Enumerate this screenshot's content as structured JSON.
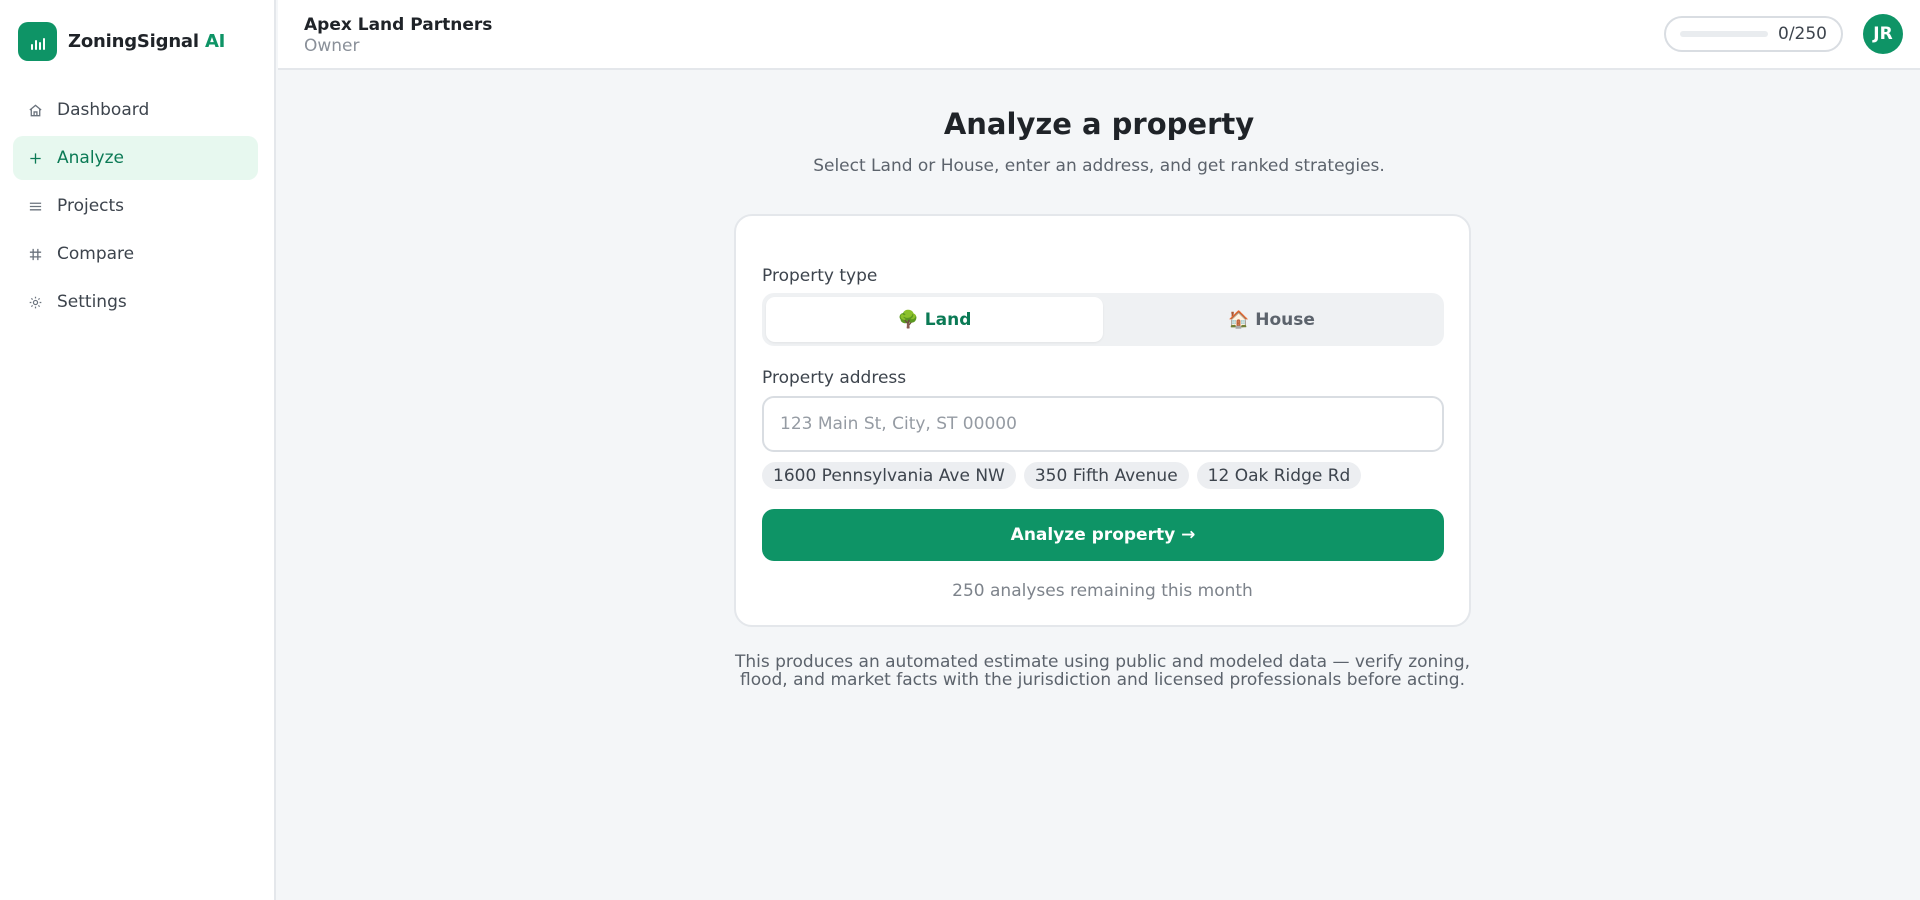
{
  "brand": {
    "name": "ZoningSignal",
    "suffix": "AI",
    "icon": "bar-chart-icon"
  },
  "nav": {
    "items": [
      {
        "label": "Dashboard",
        "icon": "home-icon",
        "active": false
      },
      {
        "label": "Analyze",
        "icon": "plus-icon",
        "active": true
      },
      {
        "label": "Projects",
        "icon": "list-icon",
        "active": false
      },
      {
        "label": "Compare",
        "icon": "grid-icon",
        "active": false
      },
      {
        "label": "Settings",
        "icon": "gear-icon",
        "active": false
      }
    ]
  },
  "header": {
    "org_name": "Apex Land Partners",
    "role": "Owner",
    "usage": {
      "label": "0/250",
      "fraction": 0
    },
    "avatar_initials": "JR"
  },
  "main": {
    "title": "Analyze a property",
    "subtitle": "Select Land or House, enter an address, and get ranked strategies.",
    "form": {
      "type_label": "Property type",
      "types": [
        {
          "emoji": "🌳",
          "label": "Land",
          "selected": true
        },
        {
          "emoji": "🏠",
          "label": "House",
          "selected": false
        }
      ],
      "address_label": "Property address",
      "address_value": "",
      "address_placeholder": "123 Main St, City, ST 00000",
      "suggestions": [
        "1600 Pennsylvania Ave NW",
        "350 Fifth Avenue",
        "12 Oak Ridge Rd"
      ],
      "submit_label": "Analyze property →",
      "remaining_text": "250 analyses remaining this month"
    },
    "disclaimer": "This produces an automated estimate using public and modeled data — verify zoning, flood, and market facts with the jurisdiction and licensed professionals before acting."
  },
  "colors": {
    "accent": "#0e9466",
    "accent_soft": "#e7f8ef",
    "background": "#f4f6f8"
  }
}
